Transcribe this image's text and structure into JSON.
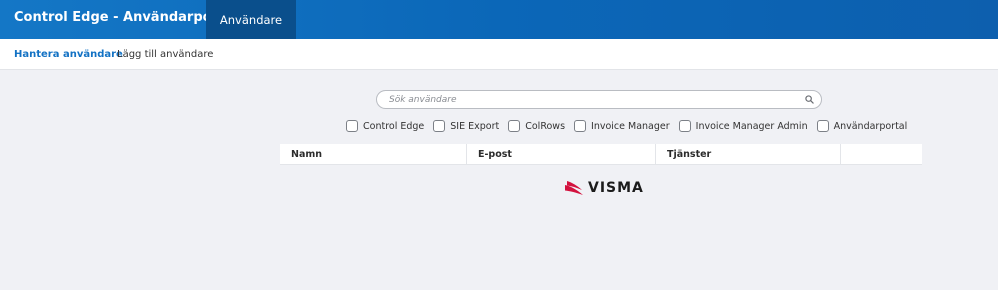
{
  "header": {
    "app_title": "Control Edge - Användarportal",
    "nav_tab": "Användare"
  },
  "subnav": {
    "manage_users": "Hantera användare",
    "add_user": "Lägg till användare"
  },
  "search": {
    "placeholder": "Sök användare",
    "value": "",
    "icon": "search-icon"
  },
  "filters": [
    {
      "label": "Control Edge",
      "checked": false
    },
    {
      "label": "SIE Export",
      "checked": false
    },
    {
      "label": "ColRows",
      "checked": false
    },
    {
      "label": "Invoice Manager",
      "checked": false
    },
    {
      "label": "Invoice Manager Admin",
      "checked": false
    },
    {
      "label": "Användarportal",
      "checked": false
    }
  ],
  "table": {
    "columns": [
      "Namn",
      "E-post",
      "Tjänster",
      ""
    ]
  },
  "footer": {
    "logo_text": "VISMA"
  },
  "colors": {
    "header_blue": "#0b67b8",
    "active_tab": "#0a4f8c",
    "link_blue": "#1372c4",
    "logo_red": "#d3123e",
    "background": "#f0f1f5"
  }
}
